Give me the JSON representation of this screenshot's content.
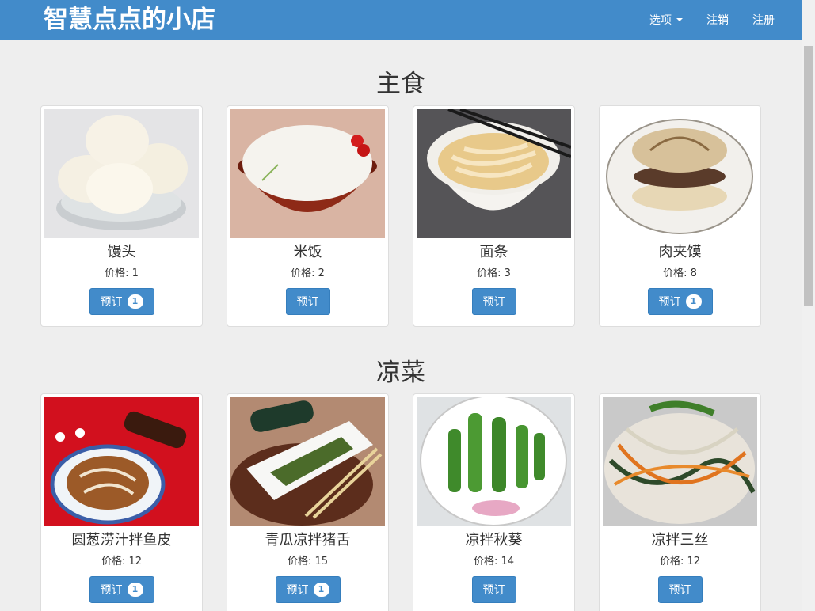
{
  "navbar": {
    "brand": "智慧点点的小店",
    "options_label": "选项",
    "logout_label": "注销",
    "register_label": "注册"
  },
  "sections": [
    {
      "title": "主食",
      "items": [
        {
          "name": "馒头",
          "price": "价格: 1",
          "button": "预订",
          "badge": "1"
        },
        {
          "name": "米饭",
          "price": "价格: 2",
          "button": "预订",
          "badge": ""
        },
        {
          "name": "面条",
          "price": "价格: 3",
          "button": "预订",
          "badge": ""
        },
        {
          "name": "肉夹馍",
          "price": "价格: 8",
          "button": "预订",
          "badge": "1"
        }
      ]
    },
    {
      "title": "凉菜",
      "items": [
        {
          "name": "圆葱涝汁拌鱼皮",
          "price": "价格: 12",
          "button": "预订",
          "badge": "1"
        },
        {
          "name": "青瓜凉拌猪舌",
          "price": "价格: 15",
          "button": "预订",
          "badge": "1"
        },
        {
          "name": "凉拌秋葵",
          "price": "价格: 14",
          "button": "预订",
          "badge": ""
        },
        {
          "name": "凉拌三丝",
          "price": "价格: 12",
          "button": "预订",
          "badge": ""
        }
      ]
    }
  ],
  "colors": {
    "navbar": "#428bca",
    "page_bg": "#eeeeee",
    "button": "#428bca"
  }
}
